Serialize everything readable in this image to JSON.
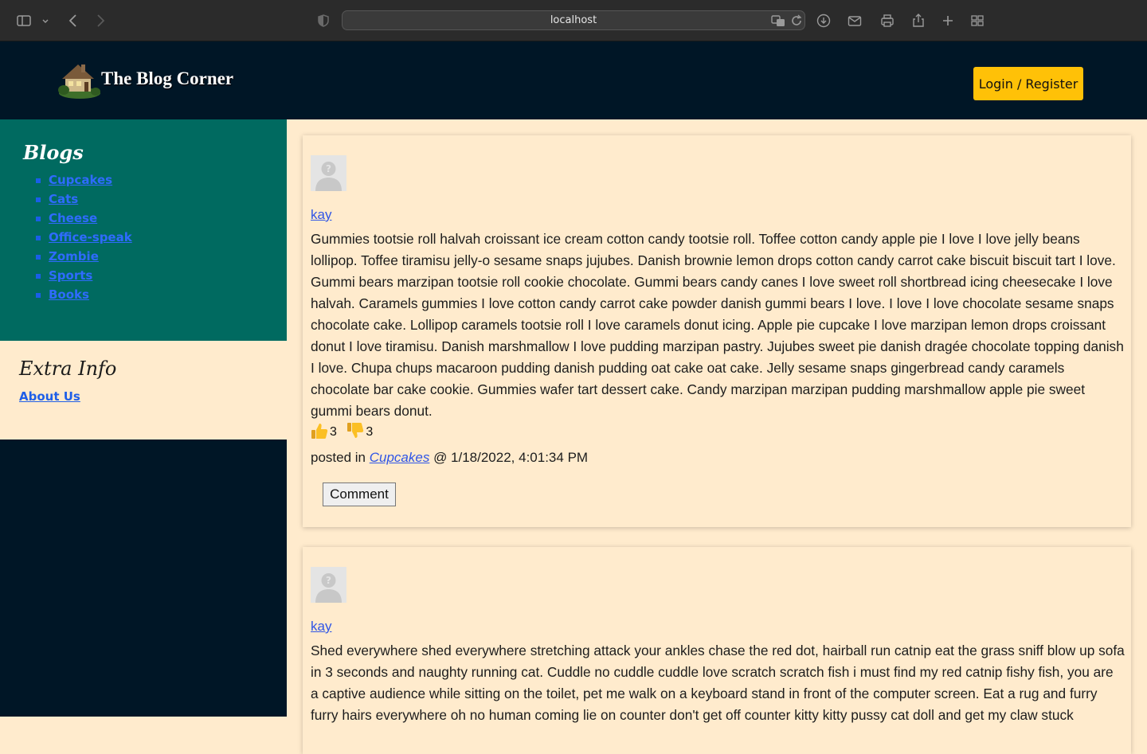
{
  "browser": {
    "url": "localhost"
  },
  "header": {
    "site_title": "The Blog Corner",
    "login_label": "Login / Register"
  },
  "sidebar": {
    "blogs_title": "Blogs",
    "blogs": [
      "Cupcakes",
      "Cats",
      "Cheese",
      "Office-speak",
      "Zombie",
      "Sports",
      "Books"
    ],
    "extra_title": "Extra Info",
    "about_label": "About Us"
  },
  "posts": [
    {
      "author": "kay",
      "body": "Gummies tootsie roll halvah croissant ice cream cotton candy tootsie roll. Toffee cotton candy apple pie I love I love jelly beans lollipop. Toffee tiramisu jelly-o sesame snaps jujubes. Danish brownie lemon drops cotton candy carrot cake biscuit biscuit tart I love. Gummi bears marzipan tootsie roll cookie chocolate. Gummi bears candy canes I love sweet roll shortbread icing cheesecake I love halvah. Caramels gummies I love cotton candy carrot cake powder danish gummi bears I love. I love I love chocolate sesame snaps chocolate cake. Lollipop caramels tootsie roll I love caramels donut icing. Apple pie cupcake I love marzipan lemon drops croissant donut I love tiramisu. Danish marshmallow I love pudding marzipan pastry. Jujubes sweet pie danish dragée chocolate topping danish I love. Chupa chups macaroon pudding danish pudding oat cake oat cake. Jelly sesame snaps gingerbread candy caramels chocolate bar cake cookie. Gummies wafer tart dessert cake. Candy marzipan marzipan pudding marshmallow apple pie sweet gummi bears donut.",
      "likes": "3",
      "dislikes": "3",
      "posted_prefix": "posted in ",
      "category": "Cupcakes",
      "posted_suffix": " @ 1/18/2022, 4:01:34 PM",
      "comment_label": "Comment"
    },
    {
      "author": "kay",
      "body": "Shed everywhere shed everywhere stretching attack your ankles chase the red dot, hairball run catnip eat the grass sniff blow up sofa in 3 seconds and naughty running cat. Cuddle no cuddle cuddle love scratch scratch fish i must find my red catnip fishy fish, you are a captive audience while sitting on the toilet, pet me walk on a keyboard stand in front of the computer screen. Eat a rug and furry furry hairs everywhere oh no human coming lie on counter don't get off counter kitty kitty pussy cat doll and get my claw stuck"
    }
  ],
  "colors": {
    "header_bg": "#001626",
    "blogs_bg": "#006a60",
    "page_bg": "#ffebcd",
    "login_bg": "#ffc107",
    "link": "#2f55e6"
  }
}
